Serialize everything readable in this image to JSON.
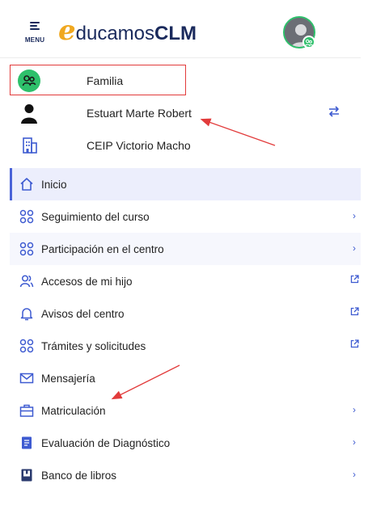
{
  "header": {
    "menu_label": "MENU",
    "logo": {
      "e": "e",
      "ducamos": "ducamos",
      "clm": "CLM"
    }
  },
  "profile": {
    "role": "Familia",
    "student": "Estuart Marte Robert",
    "school": "CEIP Victorio Macho"
  },
  "nav": [
    {
      "label": "Inicio",
      "icon": "home-icon",
      "trail": ""
    },
    {
      "label": "Seguimiento del curso",
      "icon": "apps-icon",
      "trail": "chevron-right-icon"
    },
    {
      "label": "Participación en el centro",
      "icon": "apps-icon",
      "trail": "chevron-right-icon"
    },
    {
      "label": "Accesos de mi hijo",
      "icon": "users-icon",
      "trail": "external-link-icon"
    },
    {
      "label": "Avisos del centro",
      "icon": "bell-icon",
      "trail": "external-link-icon"
    },
    {
      "label": "Trámites y solicitudes",
      "icon": "apps-icon",
      "trail": "external-link-icon"
    },
    {
      "label": "Mensajería",
      "icon": "mail-icon",
      "trail": ""
    },
    {
      "label": "Matriculación",
      "icon": "briefcase-icon",
      "trail": "chevron-right-icon"
    },
    {
      "label": "Evaluación de Diagnóstico",
      "icon": "document-icon",
      "trail": "chevron-right-icon"
    },
    {
      "label": "Banco de libros",
      "icon": "book-icon",
      "trail": "chevron-right-icon"
    }
  ],
  "colors": {
    "accent": "#3e5bd1",
    "brand_navy": "#1a2a5c",
    "brand_orange": "#f0a820",
    "green": "#2ec06b",
    "annotation_red": "#e23b3b"
  }
}
